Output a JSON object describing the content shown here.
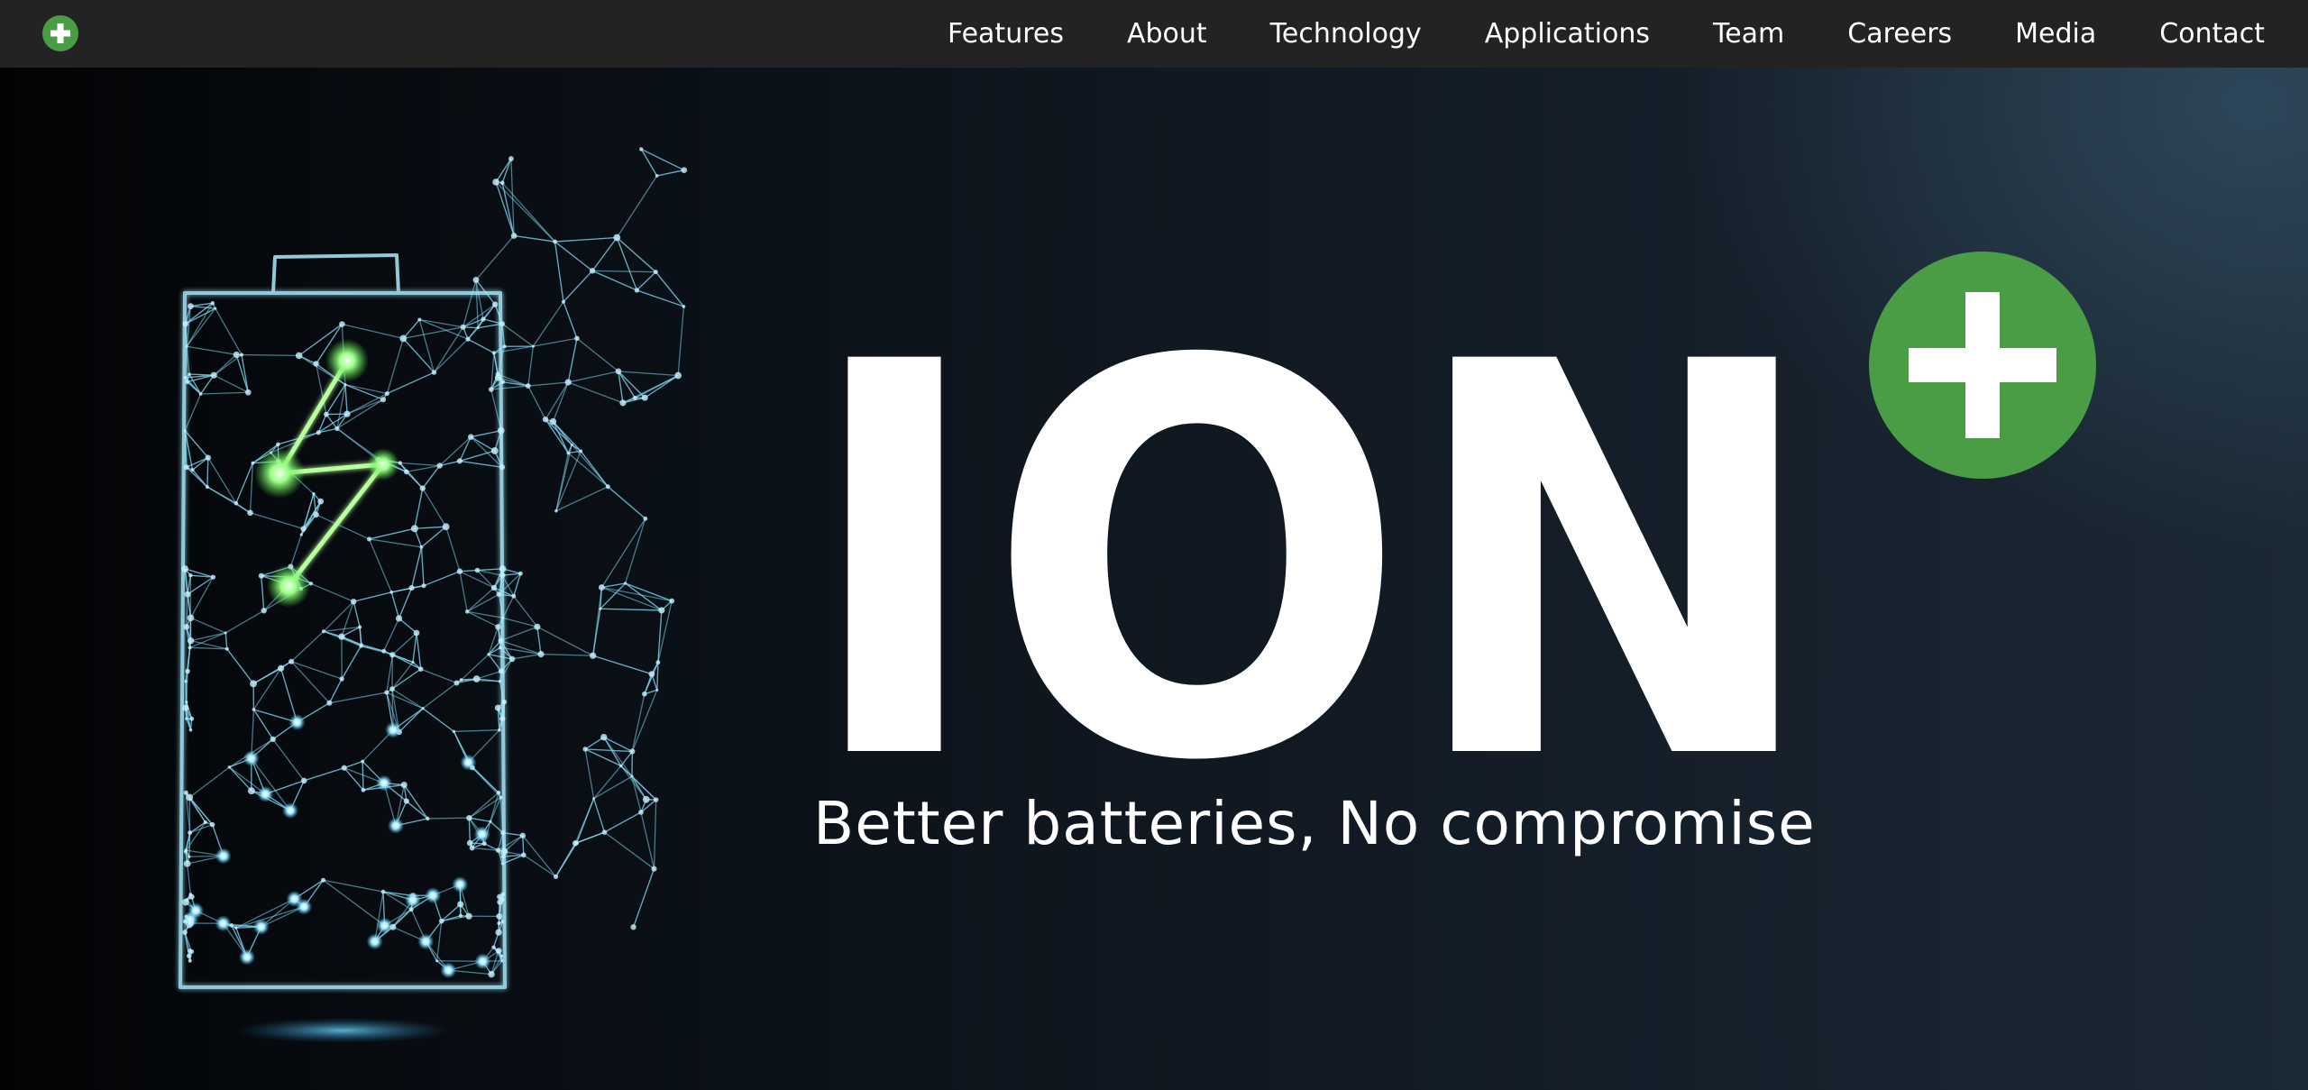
{
  "nav": {
    "logo_icon": "green-plus-circle-icon",
    "links": [
      "Features",
      "About",
      "Technology",
      "Applications",
      "Team",
      "Careers",
      "Media",
      "Contact"
    ]
  },
  "hero": {
    "wordmark": "ION",
    "wordmark_icon": "green-plus-circle-icon",
    "tagline": "Better batteries, No compromise",
    "illustration_icon": "battery-lightning-icon"
  },
  "colors": {
    "nav_bg": "#232323",
    "brand_green": "#4a9d45",
    "wordmark": "#ffffff",
    "glow_cyan": "#8fe4ff",
    "glow_green": "#9bff88"
  }
}
